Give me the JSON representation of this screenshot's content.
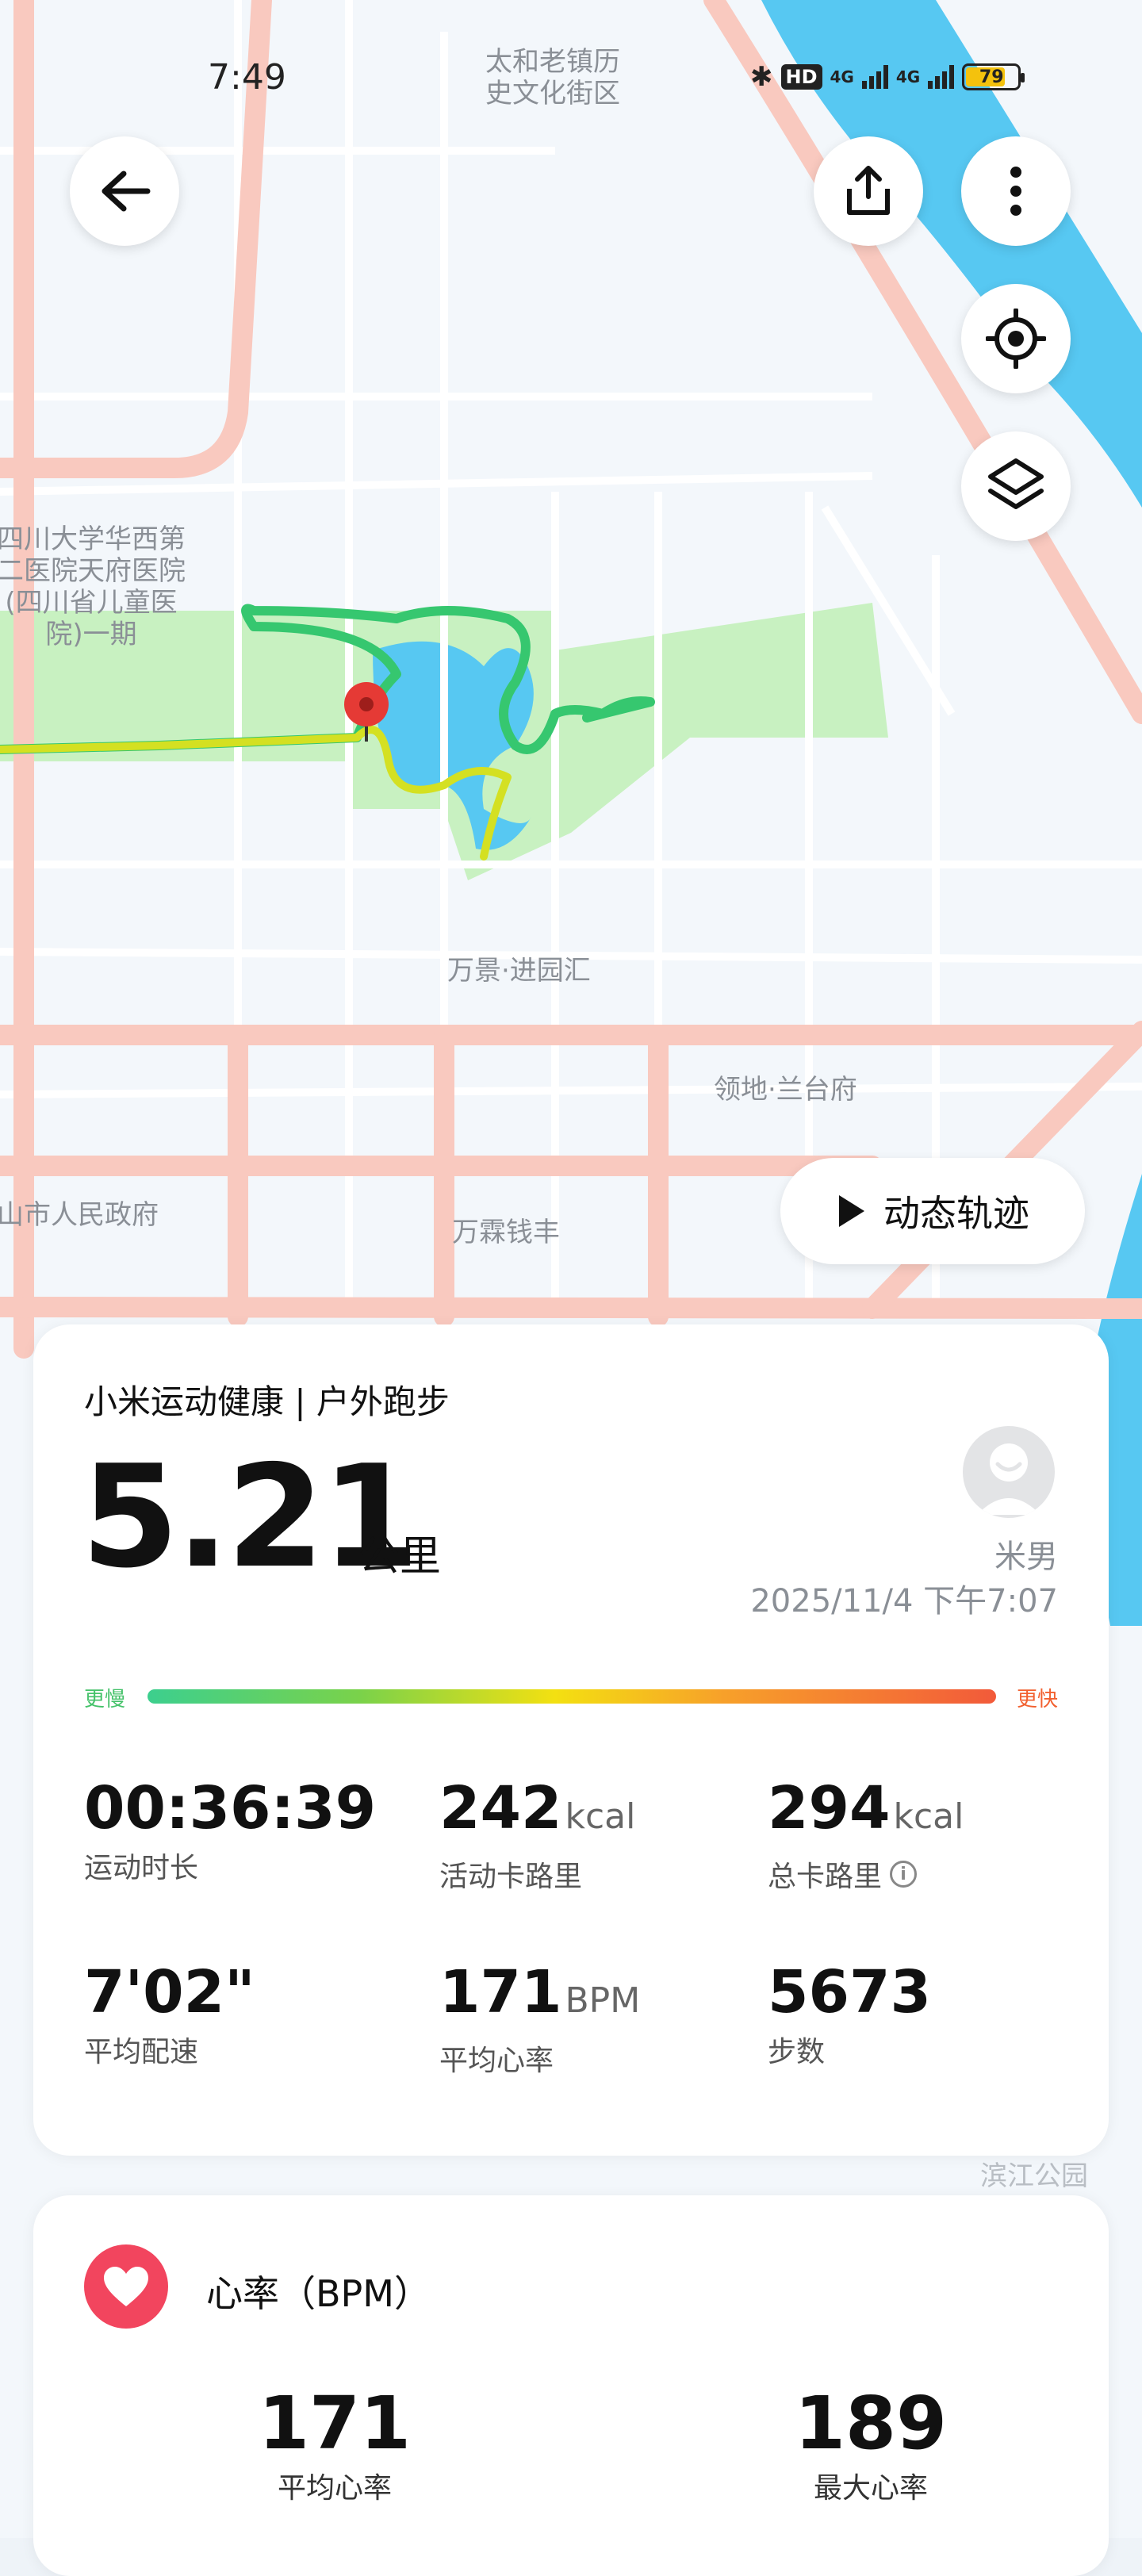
{
  "status_bar": {
    "time": "7:49",
    "network_1": "4G",
    "network_2": "4G",
    "hd_badge": "HD",
    "battery": "79"
  },
  "map": {
    "labels": {
      "taihe": "太和老镇历\n史文化街区",
      "hospital": "四川大学华西第\n二医院天府医院\n(四川省儿童医\n院)一期",
      "wanjing": "万景·进园汇",
      "lingdi": "领地·兰台府",
      "gov": "山市人民政府",
      "wanlin": "万霖钱丰",
      "binjiang": "滨江公园"
    },
    "colors": {
      "water": "#57c8f2",
      "park": "#c8f1c1",
      "road_main": "#f9c9bf",
      "marker": "#e53a35"
    }
  },
  "buttons": {
    "dynamic_track": "动态轨迹"
  },
  "workout": {
    "source_title": "小米运动健康 | 户外跑步",
    "distance": "5.21",
    "distance_unit": "公里",
    "user_name": "米男",
    "datetime": "2025/11/4 下午7:07",
    "pace_slow_label": "更慢",
    "pace_fast_label": "更快",
    "stats": {
      "duration": {
        "value": "00:36:39",
        "label": "运动时长"
      },
      "active_cal": {
        "value": "242",
        "unit": "kcal",
        "label": "活动卡路里"
      },
      "total_cal": {
        "value": "294",
        "unit": "kcal",
        "label": "总卡路里"
      },
      "avg_pace": {
        "value": "7'02\"",
        "label": "平均配速"
      },
      "avg_hr": {
        "value": "171",
        "unit": "BPM",
        "label": "平均心率"
      },
      "steps": {
        "value": "5673",
        "label": "步数"
      }
    }
  },
  "heart_rate": {
    "title": "心率（BPM）",
    "avg_value": "171",
    "avg_label": "平均心率",
    "max_value": "189",
    "max_label": "最大心率"
  }
}
